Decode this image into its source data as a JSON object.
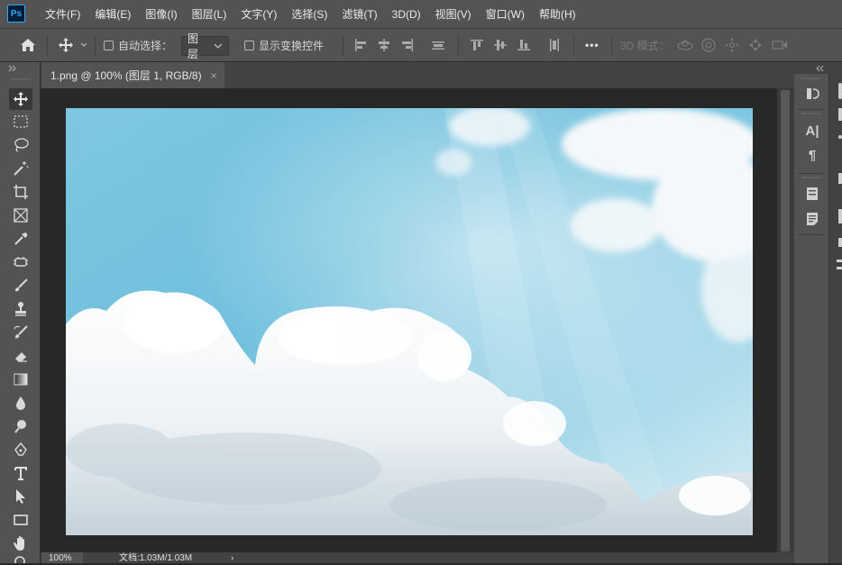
{
  "app": {
    "logo": "Ps"
  },
  "menu": [
    "文件(F)",
    "编辑(E)",
    "图像(I)",
    "图层(L)",
    "文字(Y)",
    "选择(S)",
    "滤镜(T)",
    "3D(D)",
    "视图(V)",
    "窗口(W)",
    "帮助(H)"
  ],
  "options": {
    "auto_select_label": "自动选择：",
    "auto_select_target": "图层",
    "show_transform_label": "显示变换控件",
    "more": "•••",
    "mode_3d_label": "3D 模式："
  },
  "document": {
    "tab_title": "1.png @ 100% (图层 1, RGB/8)",
    "close_glyph": "×"
  },
  "status": {
    "zoom": "100%",
    "doc_info": "文档:1.03M/1.03M",
    "arrow": "›"
  },
  "tools": [
    "move-tool",
    "rectangular-marquee-tool",
    "lasso-tool",
    "magic-wand-tool",
    "crop-tool",
    "frame-tool",
    "eyedropper-tool",
    "patch-tool",
    "brush-tool",
    "clone-stamp-tool",
    "history-brush-tool",
    "eraser-tool",
    "gradient-tool",
    "blur-tool",
    "dodge-tool",
    "pen-tool",
    "type-tool",
    "path-selection-tool",
    "rectangle-tool",
    "hand-tool",
    "zoom-tool"
  ],
  "panels": {
    "type_icon": "A|",
    "paragraph_icon": "¶"
  },
  "colors": {
    "menubar": "#535353",
    "accent_ps": "#31a8ff",
    "canvas_bg": "#282828",
    "sky": "#8fcde3"
  }
}
